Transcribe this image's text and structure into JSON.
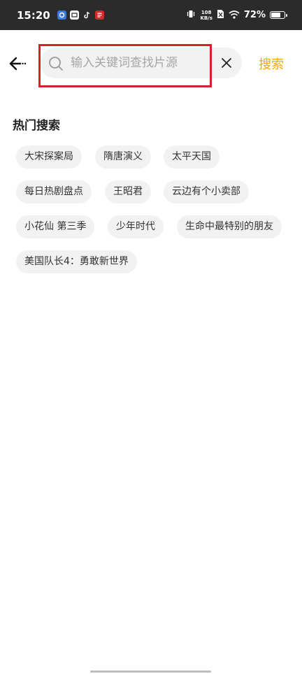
{
  "status_bar": {
    "time": "15:20",
    "net_speed_value": "108",
    "net_speed_unit": "KB/s",
    "battery_percent": "72%",
    "battery_level": 0.72
  },
  "header": {
    "back_icon": "arrow-left-icon",
    "search_placeholder": "输入关键词查找片源",
    "search_value": "",
    "search_button_label": "搜索",
    "accent_color": "#f0a800",
    "highlight_color": "#d8202c"
  },
  "hot_searches": {
    "title": "热门搜索",
    "tags": [
      "大宋探案局",
      "隋唐演义",
      "太平天国",
      "每日热剧盘点",
      "王昭君",
      "云边有个小卖部",
      "小花仙 第三季",
      "少年时代",
      "生命中最特别的朋友",
      "美国队长4：勇敢新世界"
    ]
  }
}
